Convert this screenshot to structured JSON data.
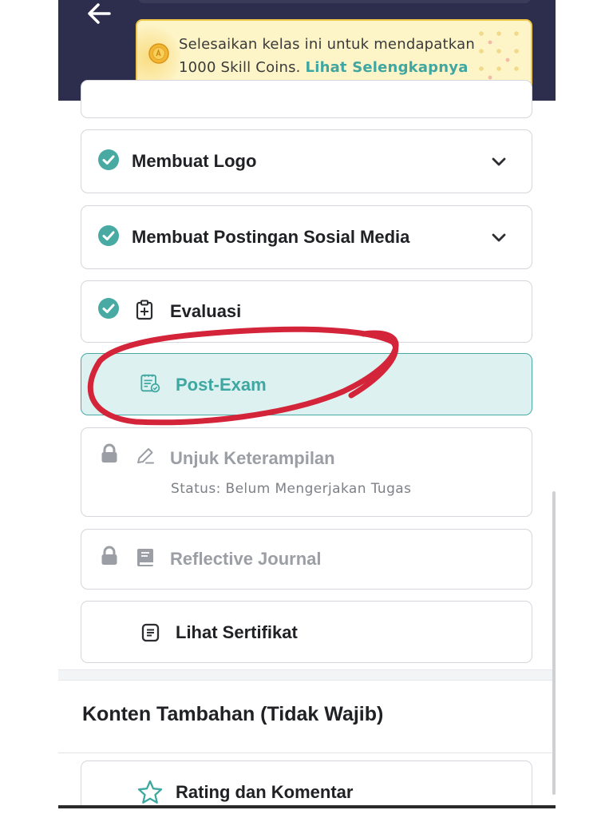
{
  "header": {
    "back_icon": "arrow-left-icon",
    "banner": {
      "icon": "coin-icon",
      "text_line1": "Selesaikan kelas ini untuk mendapatkan",
      "text_line2": "1000 Skill Coins.",
      "link": "Lihat Selengkapnya"
    }
  },
  "modules": [
    {
      "label": "Membuat Logo",
      "status": "completed",
      "icon": "check-circle-icon",
      "expand_icon": "chevron-down-icon"
    },
    {
      "label": "Membuat Postingan Sosial Media",
      "status": "completed",
      "icon": "check-circle-icon",
      "expand_icon": "chevron-down-icon"
    },
    {
      "label": "Evaluasi",
      "status": "completed",
      "icon": "clipboard-icon"
    },
    {
      "label": "Post-Exam",
      "status": "active",
      "icon": "exam-checklist-icon"
    },
    {
      "label": "Unjuk Keterampilan",
      "status": "locked",
      "icon": "pencil-icon",
      "subtext": "Status: Belum Mengerjakan Tugas"
    },
    {
      "label": "Reflective Journal",
      "status": "locked",
      "icon": "journal-book-icon"
    },
    {
      "label": "Lihat Sertifikat",
      "status": "available",
      "icon": "certificate-icon"
    }
  ],
  "extra_section": {
    "title": "Konten Tambahan (Tidak Wajib)",
    "items": [
      {
        "label": "Rating dan Komentar",
        "icon": "star-icon"
      }
    ]
  },
  "colors": {
    "header_bg": "#2d2e4d",
    "banner_bg": "#fdf4c7",
    "banner_border": "#f1c748",
    "accent_teal": "#3fa7a1",
    "active_bg": "#ddf1f0",
    "locked_gray": "#9b9ea4",
    "annotation_red": "#d4243a"
  },
  "annotation": {
    "shape": "hand-drawn circle",
    "target": "Post-Exam"
  }
}
